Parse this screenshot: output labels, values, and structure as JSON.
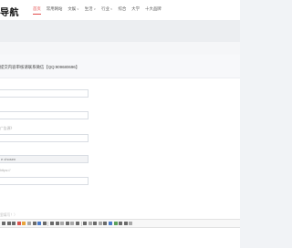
{
  "site": {
    "logo_text": "导航"
  },
  "nav": {
    "items": [
      {
        "label": "首页",
        "active": true,
        "dropdown": false
      },
      {
        "label": "常用网站",
        "active": false,
        "dropdown": false
      },
      {
        "label": "文娱",
        "active": false,
        "dropdown": true
      },
      {
        "label": "生活",
        "active": false,
        "dropdown": true
      },
      {
        "label": "行业",
        "active": false,
        "dropdown": true
      },
      {
        "label": "综合",
        "active": false,
        "dropdown": false
      },
      {
        "label": "大学",
        "active": false,
        "dropdown": false
      },
      {
        "label": "十大品牌",
        "active": false,
        "dropdown": false
      }
    ],
    "caret": "∨"
  },
  "form": {
    "title": "提交内容审核请联系微信【QQ:909680696】",
    "fields": [
      {
        "name": "field-1",
        "value": ""
      },
      {
        "name": "field-2",
        "value": ""
      },
      {
        "name": "field-3",
        "value": ""
      },
      {
        "name": "field-4",
        "value": ""
      }
    ],
    "hint_1": "广告源》",
    "select_value": "e chosen",
    "hint_2": "https://",
    "editor_hint": "里填写！）"
  },
  "colors": {
    "accent": "#e34b4b",
    "background": "#f1f3f6"
  }
}
